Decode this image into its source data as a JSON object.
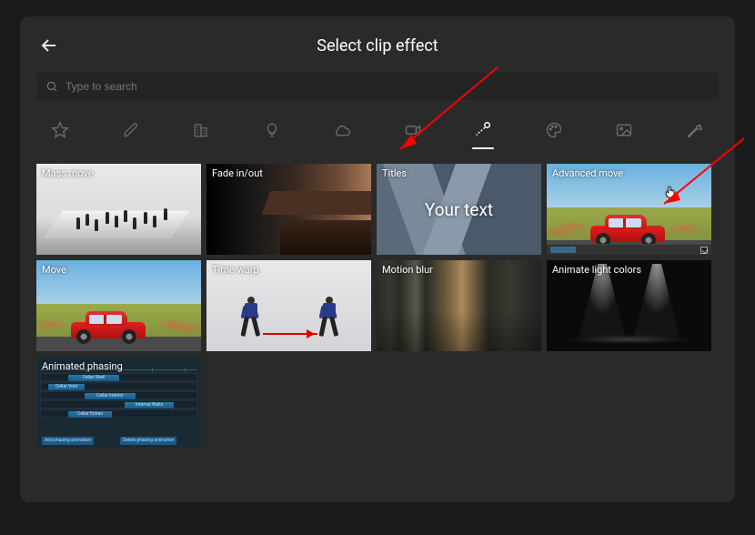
{
  "header": {
    "title": "Select clip effect"
  },
  "search": {
    "placeholder": "Type to search"
  },
  "categories": [
    {
      "name": "favorites-icon"
    },
    {
      "name": "pencil-icon"
    },
    {
      "name": "building-icon"
    },
    {
      "name": "lightbulb-icon"
    },
    {
      "name": "cloud-icon"
    },
    {
      "name": "camera-icon"
    },
    {
      "name": "motion-path-icon",
      "active": true
    },
    {
      "name": "palette-icon"
    },
    {
      "name": "image-icon"
    },
    {
      "name": "wrench-icon"
    }
  ],
  "effects": [
    {
      "label": "Mass move"
    },
    {
      "label": "Fade in/out"
    },
    {
      "label": "Titles",
      "overlay_text": "Your text"
    },
    {
      "label": "Advanced move",
      "selected": true
    },
    {
      "label": "Move"
    },
    {
      "label": "Time warp"
    },
    {
      "label": "Motion blur"
    },
    {
      "label": "Animate light colors"
    },
    {
      "label": "Animated phasing"
    }
  ],
  "phasing_preview": {
    "rows": [
      "Cellar Shell",
      "Cellar Void",
      "Cellar Interior",
      "Internal Walls",
      "Cellar Extras"
    ],
    "add_button": "Add phasing animation",
    "delete_button": "Delete phasing animation"
  },
  "colors": {
    "accent_red": "#ff0000",
    "panel": "#2a2a2a",
    "bg": "#1a1a1a"
  }
}
